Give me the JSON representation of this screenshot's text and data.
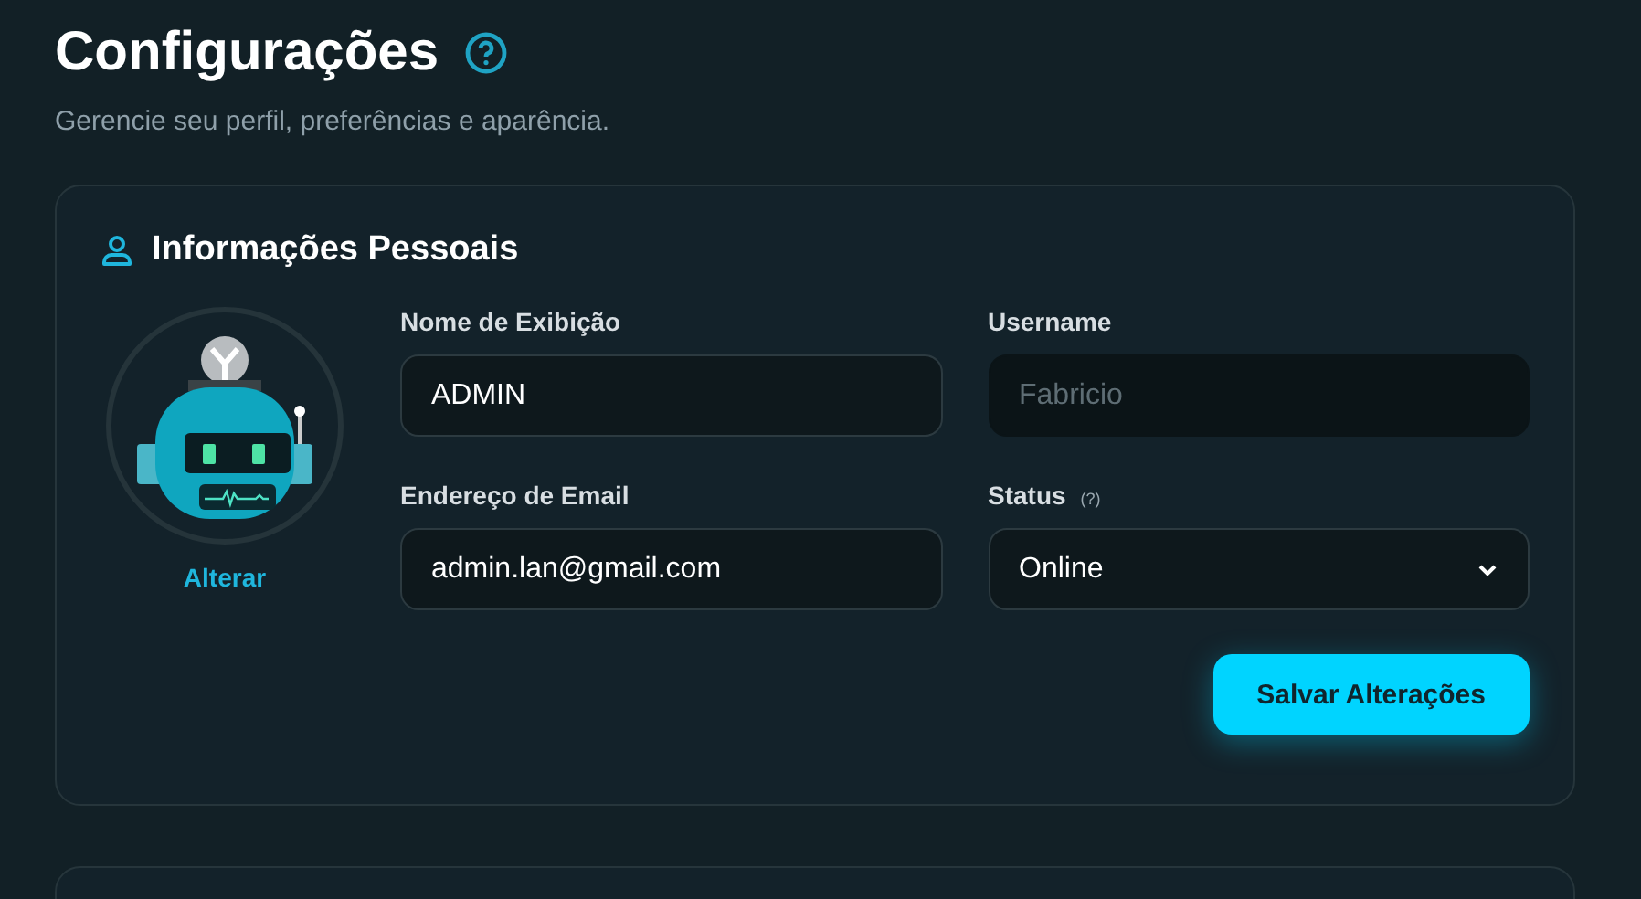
{
  "header": {
    "title": "Configurações",
    "subtitle": "Gerencie seu perfil, preferências e aparência."
  },
  "profile_card": {
    "title": "Informações Pessoais",
    "avatar_action": "Alterar",
    "fields": [
      {
        "kind": "input",
        "label": "Nome de Exibição",
        "value": "ADMIN",
        "disabled": false
      },
      {
        "kind": "input",
        "label": "Username",
        "placeholder": "Fabricio",
        "disabled": true
      },
      {
        "kind": "input",
        "label": "Endereço de Email",
        "value": "admin.lan@gmail.com",
        "disabled": false
      },
      {
        "kind": "select",
        "label": "Status",
        "hint": "(?)",
        "value": "Online",
        "disabled": false
      }
    ],
    "save_button": "Salvar Alterações"
  }
}
